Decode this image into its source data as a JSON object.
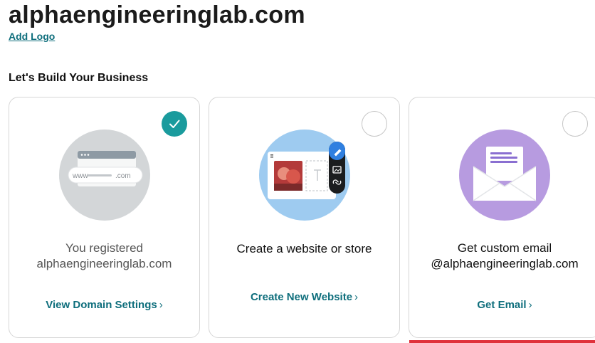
{
  "header": {
    "domain": "alphaengineeringlab.com",
    "add_logo": "Add Logo"
  },
  "section": {
    "heading": "Let's Build Your Business"
  },
  "cards": [
    {
      "status": "completed",
      "illustration_text_www": "www",
      "illustration_text_com": ".com",
      "line1": "You registered",
      "line2": "alphaengineeringlab.com",
      "link": "View Domain Settings",
      "chevron": "›"
    },
    {
      "status": "not-started",
      "line1": "Create a website or store",
      "link": "Create New Website",
      "chevron": "›"
    },
    {
      "status": "not-started",
      "line1": "Get custom email",
      "line2": "@alphaengineeringlab.com",
      "link": "Get Email",
      "chevron": "›"
    }
  ],
  "colors": {
    "accent": "#0e6e7c",
    "check": "#1a9b9d",
    "domain_circle": "#d3d6d8",
    "website_circle": "#9ecbf0",
    "email_circle": "#b79be0",
    "alert_bar": "#e0313b"
  }
}
